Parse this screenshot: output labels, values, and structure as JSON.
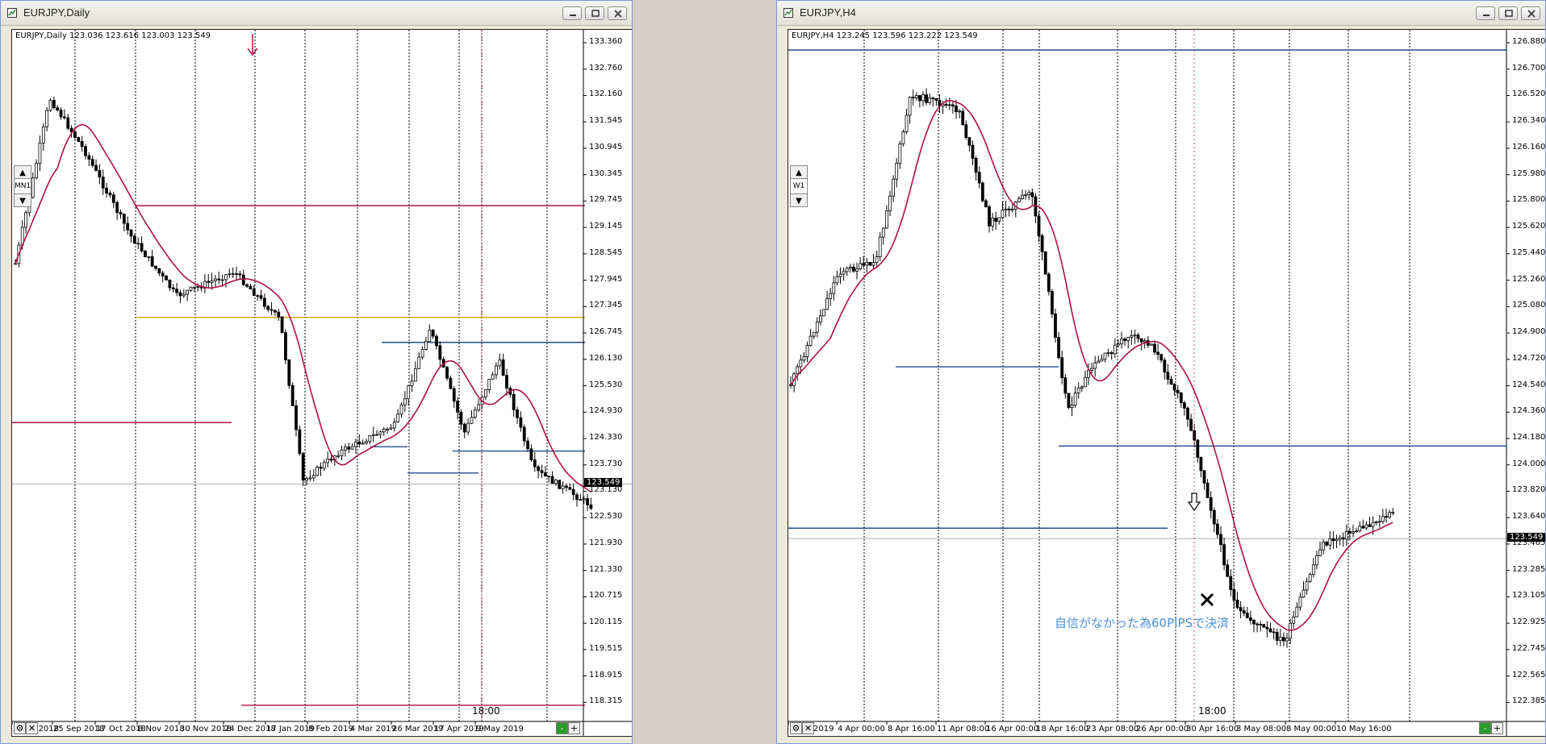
{
  "left": {
    "window_title": "EURJPY,Daily",
    "chart_header": "EURJPY,Daily  123.036 123.616 123.003 123.549",
    "timeframe_label": "MN1",
    "current_price": "123.549",
    "session_label": "18:00",
    "price_labels": [
      "133.360",
      "132.760",
      "132.160",
      "131.545",
      "130.945",
      "130.345",
      "129.745",
      "129.145",
      "128.545",
      "127.945",
      "127.345",
      "126.745",
      "126.130",
      "125.530",
      "124.930",
      "124.330",
      "123.730",
      "123.130",
      "122.530",
      "121.930",
      "121.330",
      "120.715",
      "120.115",
      "119.515",
      "118.915",
      "118.315"
    ],
    "date_labels": [
      "3 Sep 2018",
      "25 Sep 2018",
      "17 Oct 2018",
      "8 Nov 2018",
      "30 Nov 2018",
      "24 Dec 2018",
      "17 Jan 2019",
      "8 Feb 2019",
      "4 Mar 2019",
      "26 Mar 2019",
      "17 Apr 2019",
      "9 May 2019"
    ]
  },
  "right": {
    "window_title": "EURJPY,H4",
    "chart_header": "EURJPY,H4  123.245 123.596 123.222 123.549",
    "timeframe_label": "W1",
    "current_price": "123.549",
    "session_label": "18:00",
    "annotation": "自信がなかった為60PIPSで決済",
    "price_labels": [
      "126.880",
      "126.700",
      "126.520",
      "126.340",
      "126.160",
      "125.980",
      "125.800",
      "125.620",
      "125.440",
      "125.260",
      "125.080",
      "124.900",
      "124.720",
      "124.540",
      "124.360",
      "124.180",
      "124.000",
      "123.820",
      "123.640",
      "123.465",
      "123.285",
      "123.105",
      "122.925",
      "122.745",
      "122.565",
      "122.385"
    ],
    "date_labels": [
      "1 Apr 2019",
      "4 Apr 00:00",
      "8 Apr 16:00",
      "11 Apr 08:00",
      "16 Apr 00:00",
      "18 Apr 16:00",
      "23 Apr 08:00",
      "26 Apr 00:00",
      "30 Apr 16:00",
      "3 May 08:00",
      "8 May 00:00",
      "10 May 16:00"
    ]
  },
  "colors": {
    "bull_candle": "#ffffff",
    "bear_candle": "#000000",
    "moving_average": "#b01040",
    "support_line": "#1f4e8c",
    "resistance_line": "#b01040",
    "gold_line": "#d4a000",
    "annotation_text": "#4a90d9",
    "price_tag_bg": "#000000"
  },
  "icons": {
    "down_arrow": "down-arrow-icon",
    "exit_cross": "cross-icon",
    "entry_arrow": "entry-arrow-icon"
  }
}
